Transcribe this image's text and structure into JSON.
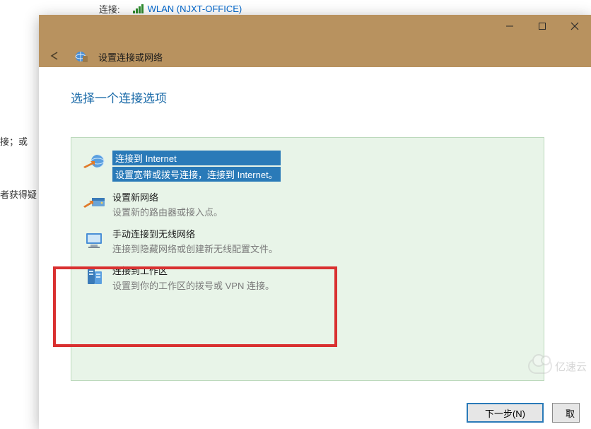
{
  "background": {
    "connection_label": "连接:",
    "connection_name": "WLAN (NJXT-OFFICE)",
    "left_text_1": "接；或",
    "left_text_2": "者获得疑"
  },
  "window": {
    "breadcrumb": "设置连接或网络",
    "heading": "选择一个连接选项",
    "options": [
      {
        "title": "连接到 Internet",
        "desc": "设置宽带或拨号连接，连接到 Internet。"
      },
      {
        "title": "设置新网络",
        "desc": "设置新的路由器或接入点。"
      },
      {
        "title": "手动连接到无线网络",
        "desc": "连接到隐藏网络或创建新无线配置文件。"
      },
      {
        "title": "连接到工作区",
        "desc": "设置到你的工作区的拨号或 VPN 连接。"
      }
    ],
    "buttons": {
      "next": "下一步(N)",
      "cancel": "取"
    }
  },
  "watermark": "亿速云"
}
